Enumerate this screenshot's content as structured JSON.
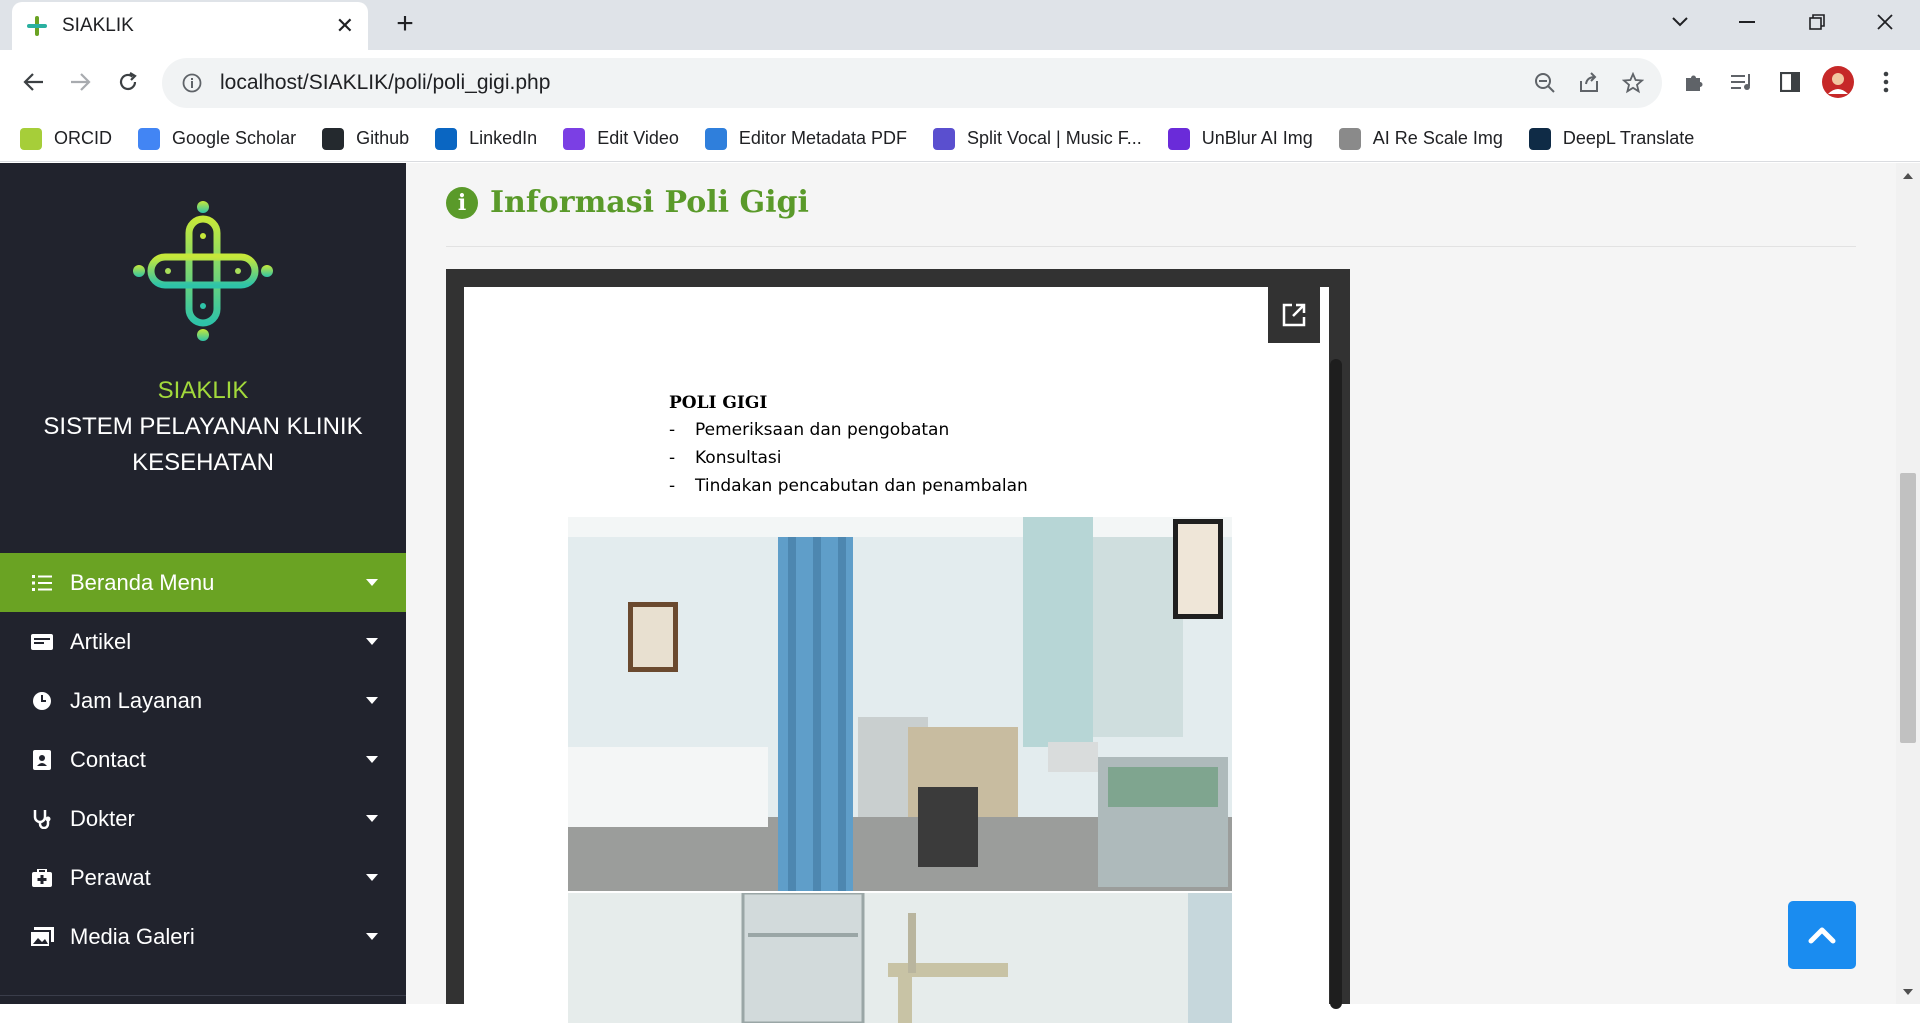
{
  "browser": {
    "tab_title": "SIAKLIK",
    "url": "localhost/SIAKLIK/poli/poli_gigi.php",
    "bookmarks": [
      {
        "label": "ORCID",
        "icon": "orcid-icon",
        "color": "#a6ce39"
      },
      {
        "label": "Google Scholar",
        "icon": "google-scholar-icon",
        "color": "#4285f4"
      },
      {
        "label": "Github",
        "icon": "github-icon",
        "color": "#24292e"
      },
      {
        "label": "LinkedIn",
        "icon": "linkedin-icon",
        "color": "#0a66c2"
      },
      {
        "label": "Edit Video",
        "icon": "clapperboard-icon",
        "color": "#7b3fe4"
      },
      {
        "label": "Editor Metadata PDF",
        "icon": "cloud-gear-icon",
        "color": "#2f7fdc"
      },
      {
        "label": "Split Vocal | Music F...",
        "icon": "vocal-remover-icon",
        "color": "#5a4fcf"
      },
      {
        "label": "UnBlur AI Img",
        "icon": "unblur-icon",
        "color": "#6a2bd9"
      },
      {
        "label": "AI Re Scale Img",
        "icon": "rescale-icon",
        "color": "#8a8a8a"
      },
      {
        "label": "DeepL Translate",
        "icon": "deepl-icon",
        "color": "#0f2b46"
      }
    ]
  },
  "sidebar": {
    "app_name": "SIAKLIK",
    "subtitle_line1": "SISTEM PELAYANAN KLINIK",
    "subtitle_line2": "KESEHATAN",
    "menu": [
      {
        "label": "Beranda Menu",
        "icon": "list-icon",
        "active": true
      },
      {
        "label": "Artikel",
        "icon": "newspaper-icon",
        "active": false
      },
      {
        "label": "Jam Layanan",
        "icon": "clock-icon",
        "active": false
      },
      {
        "label": "Contact",
        "icon": "contact-book-icon",
        "active": false
      },
      {
        "label": "Dokter",
        "icon": "stethoscope-icon",
        "active": false
      },
      {
        "label": "Perawat",
        "icon": "medkit-icon",
        "active": false
      },
      {
        "label": "Media Galeri",
        "icon": "photo-gallery-icon",
        "active": false
      }
    ]
  },
  "main": {
    "heading": "Informasi Poli Gigi",
    "document": {
      "title": "POLI GIGI",
      "items": [
        "Pemeriksaan dan pengobatan",
        "Konsultasi",
        "Tindakan pencabutan dan penambalan"
      ]
    }
  },
  "colors": {
    "sidebar_bg": "#21232d",
    "accent_green": "#6aa323",
    "heading_green": "#5a9a2a",
    "brand_green": "#a2d93b",
    "scroll_top_blue": "#1a8cf0"
  }
}
